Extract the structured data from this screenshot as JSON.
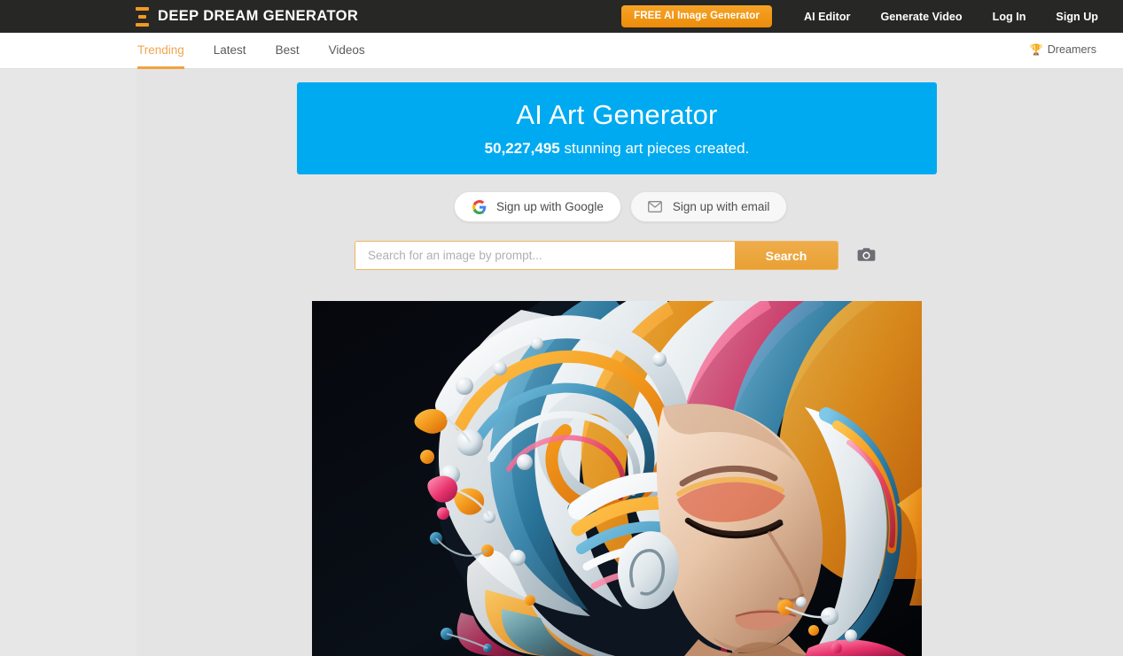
{
  "header": {
    "logo_icon": "hourglass-logo-icon",
    "brand": "DEEP DREAM GENERATOR",
    "cta_label": "FREE AI Image Generator",
    "links": [
      {
        "label": "AI Editor"
      },
      {
        "label": "Generate Video"
      },
      {
        "label": "Log In"
      },
      {
        "label": "Sign Up"
      }
    ],
    "colors": {
      "bar_background": "#272726",
      "cta_background": "#f0900f",
      "brand_accent": "#f09a22"
    }
  },
  "subnav": {
    "tabs": [
      {
        "label": "Trending",
        "active": true
      },
      {
        "label": "Latest",
        "active": false
      },
      {
        "label": "Best",
        "active": false
      },
      {
        "label": "Videos",
        "active": false
      }
    ],
    "dreamers": {
      "icon": "trophy-icon",
      "glyph": "🏆",
      "label": "Dreamers"
    },
    "active_color": "#f0a650"
  },
  "hero": {
    "title": "AI Art Generator",
    "count": "50,227,495",
    "subtitle_rest": " stunning art pieces created.",
    "background": "#00aaf0"
  },
  "signup": {
    "google": {
      "icon": "google-icon",
      "label": "Sign up with Google"
    },
    "email": {
      "icon": "envelope-icon",
      "label": "Sign up with email"
    }
  },
  "search": {
    "placeholder": "Search for an image by prompt...",
    "value": "",
    "button_label": "Search",
    "camera_icon": "camera-icon",
    "accent": "#eda843"
  },
  "artwork": {
    "alt": "Colorful swirling liquid-paint portrait of a woman's face with flowing multicolored hair",
    "background": "#000000"
  }
}
